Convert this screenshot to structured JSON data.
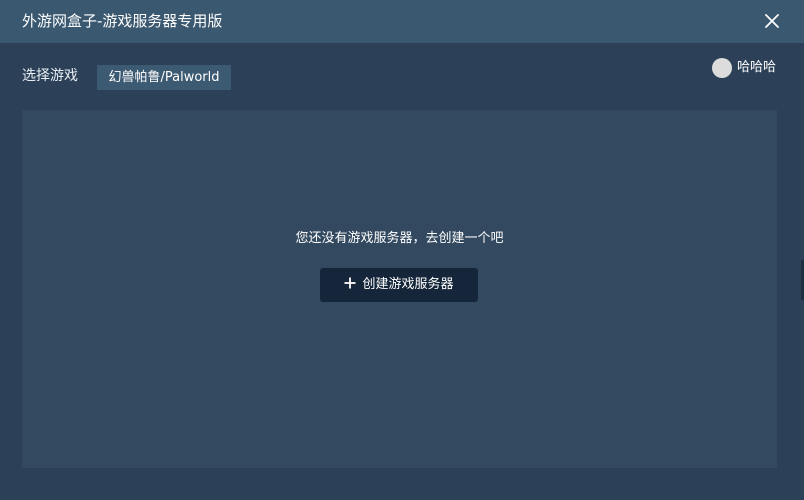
{
  "window": {
    "title": "外游网盒子-游戏服务器专用版"
  },
  "toolbar": {
    "select_game_label": "选择游戏",
    "selected_game": "幻兽帕鲁/Palworld"
  },
  "user": {
    "name": "哈哈哈"
  },
  "main": {
    "empty_message": "您还没有游戏服务器，去创建一个吧",
    "create_button_label": "创建游戏服务器"
  },
  "icons": {
    "close": "close-icon",
    "plus": "plus-icon",
    "avatar": "avatar"
  },
  "colors": {
    "titlebar": "#3a5870",
    "window_bg": "#2c4158",
    "panel_bg": "#33495f",
    "button_bg": "#15263a",
    "select_bg": "#3d5a73"
  }
}
